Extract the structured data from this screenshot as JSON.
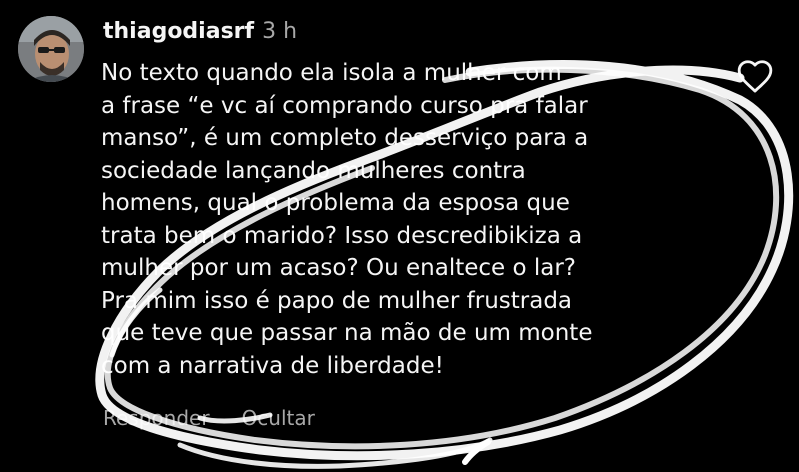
{
  "comment": {
    "username": "thiagodiasrf",
    "time": "3 h",
    "lines": [
      "No texto quando ela isola a mulher com",
      "a frase “e vc aí comprando curso pra falar",
      "manso”, é um completo desserviço para a",
      "sociedade lançando mulheres contra",
      "homens, qual o problema da esposa que",
      "trata bem o marido? Isso descredibikiza a",
      "mulher por um acaso? Ou enaltece o lar?",
      "Pra mim isso é papo de mulher frustrada",
      "que teve que passar na mão de um monte",
      "com a narrativa de liberdade!"
    ],
    "reply_label": "Responder",
    "hide_label": "Ocultar",
    "like_icon": "heart-outline-icon"
  },
  "colors": {
    "background": "#000000",
    "text": "#f5f5f5",
    "secondary_text": "#a8a8a8",
    "scribble": "#ffffff"
  }
}
